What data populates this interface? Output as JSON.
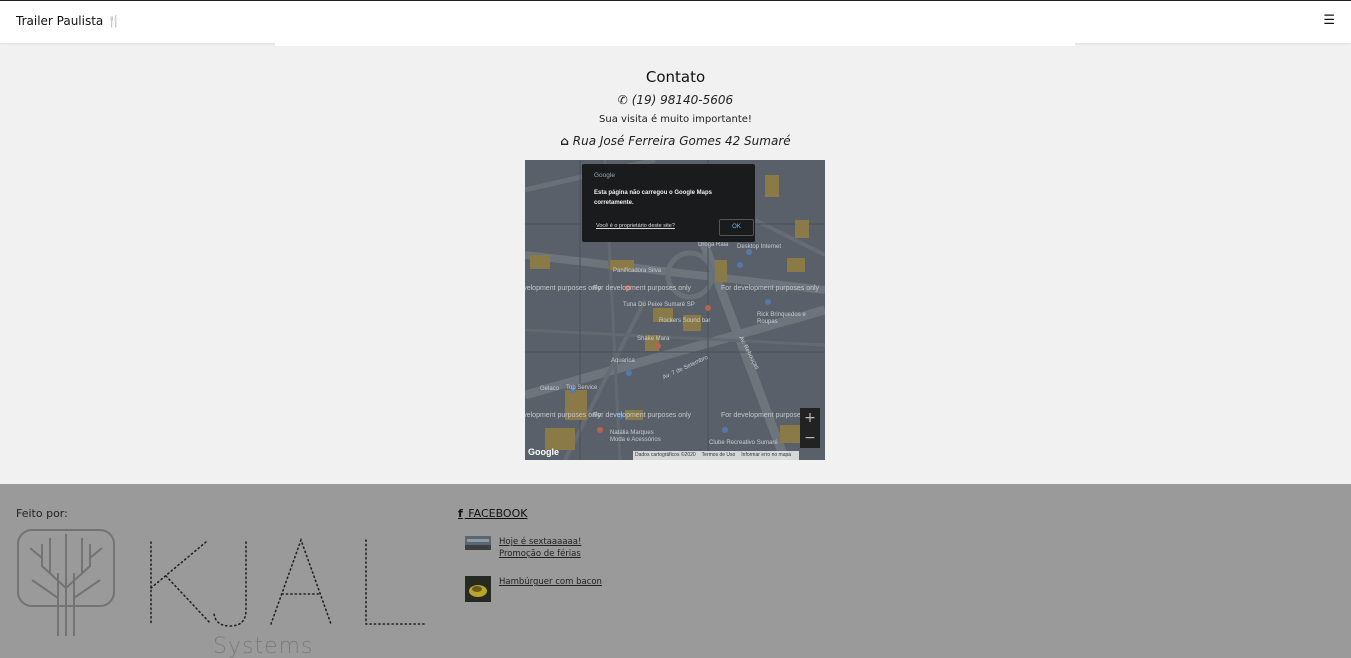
{
  "navbar": {
    "brand": "Trailer Paulista",
    "brand_icon": "🍴",
    "menu_icon": "☰"
  },
  "contact": {
    "title": "Contato",
    "phone_icon": "✆",
    "phone": "(19) 98140-5606",
    "visit_text": "Sua visita é muito importante!",
    "home_icon": "⌂",
    "address": "Rua José Ferreira Gomes 42 Sumaré"
  },
  "map": {
    "dialog_brand": "Google",
    "error_message": "Esta página não carregou o Google Maps corretamente.",
    "owner_link": "Você é o proprietário deste site?",
    "ok_label": "OK",
    "dev_watermark": "For development purposes only",
    "zoom_in": "+",
    "zoom_out": "−",
    "google_logo": "Google",
    "attribution": [
      "Dados cartográficos ©2020",
      "Termos de Uso",
      "Informar erro no mapa"
    ],
    "labels": {
      "shake": "Shake Mara",
      "aquarica": "Aquarica",
      "top_service": "Top Service",
      "gelaco": "Gelaco",
      "natalia": "Natália Marques Moda e Acessórios",
      "clube": "Clube Recreativo Sumaré",
      "rockers": "Rockers Sound bar",
      "tuna": "Tuna Do Peixe Sumaré SP",
      "panificadora": "Panificadora Silva",
      "drogaria": "Droga Raia",
      "desktop": "Desktop Internet",
      "rick": "Rick Brinquedos e Roupas",
      "av7": "Av. 7 de Setembro",
      "avreb": "Av. Rebouças"
    }
  },
  "footer": {
    "made_by": "Feito por:",
    "logo_text": "KJAL",
    "logo_sub": "Systems",
    "facebook_icon": "f",
    "facebook_label": " FACEBOOK",
    "posts": [
      {
        "title": "Hoje é sextaaaaaa!",
        "subtitle": "Promoção de férias"
      },
      {
        "title": "Hambúrguer com bacon",
        "subtitle": ""
      }
    ]
  }
}
